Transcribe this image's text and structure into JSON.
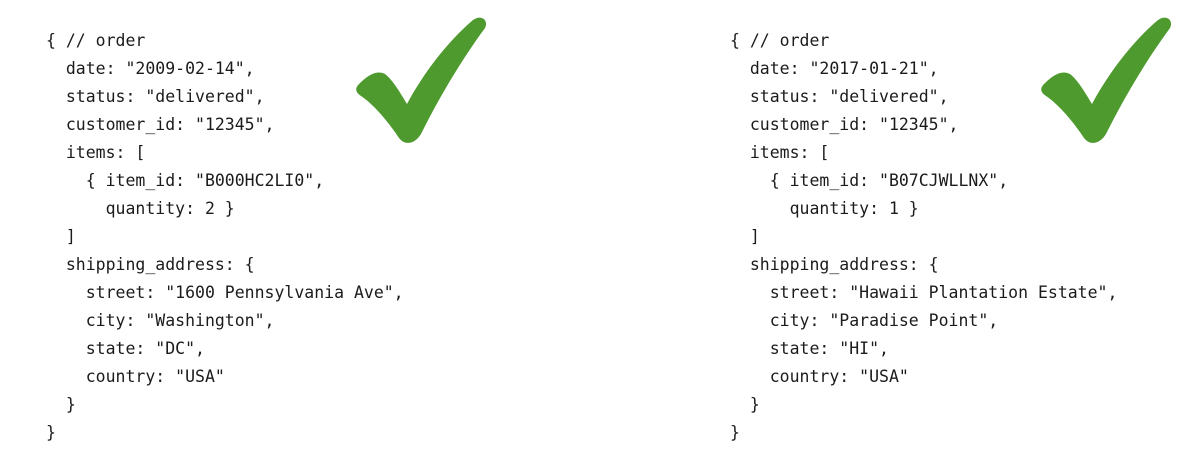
{
  "documents": [
    {
      "lines": [
        "{ // order",
        "  date: \"2009-02-14\",",
        "  status: \"delivered\",",
        "  customer_id: \"12345\",",
        "  items: [",
        "    { item_id: \"B000HC2LI0\",",
        "      quantity: 2 }",
        "  ]",
        "  shipping_address: {",
        "    street: \"1600 Pennsylvania Ave\",",
        "    city: \"Washington\",",
        "    state: \"DC\",",
        "    country: \"USA\"",
        "  }",
        "}"
      ],
      "icon": "checkmark-icon",
      "icon_color": "#4e9a2e"
    },
    {
      "lines": [
        "{ // order",
        "  date: \"2017-01-21\",",
        "  status: \"delivered\",",
        "  customer_id: \"12345\",",
        "  items: [",
        "    { item_id: \"B07CJWLLNX\",",
        "      quantity: 1 }",
        "  ]",
        "  shipping_address: {",
        "    street: \"Hawaii Plantation Estate\",",
        "    city: \"Paradise Point\",",
        "    state: \"HI\",",
        "    country: \"USA\"",
        "  }",
        "}"
      ],
      "icon": "checkmark-icon",
      "icon_color": "#4e9a2e"
    }
  ]
}
